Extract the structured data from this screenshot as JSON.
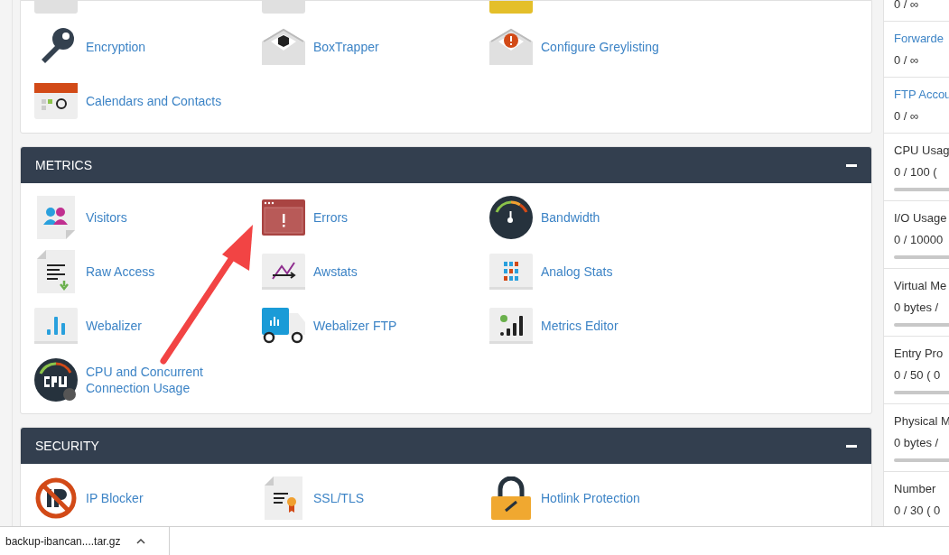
{
  "top_card": {
    "clipped_icons": [
      {
        "kind": "grey"
      },
      {
        "kind": "grey"
      },
      {
        "kind": "yellow"
      }
    ],
    "items": [
      {
        "label": "Encryption",
        "kind": "key"
      },
      {
        "label": "BoxTrapper",
        "kind": "box-envelope"
      },
      {
        "label": "Configure Greylisting",
        "kind": "alert-envelope"
      },
      {
        "label": "Calendars and Contacts",
        "kind": "calendar"
      }
    ]
  },
  "sections": [
    {
      "title": "METRICS",
      "expanded": true,
      "items": [
        {
          "label": "Visitors",
          "kind": "visitors"
        },
        {
          "label": "Errors",
          "kind": "errors"
        },
        {
          "label": "Bandwidth",
          "kind": "gauge"
        },
        {
          "label": "Raw Access",
          "kind": "raw"
        },
        {
          "label": "Awstats",
          "kind": "awstats"
        },
        {
          "label": "Analog Stats",
          "kind": "analog"
        },
        {
          "label": "Webalizer",
          "kind": "webalizer"
        },
        {
          "label": "Webalizer FTP",
          "kind": "truck"
        },
        {
          "label": "Metrics Editor",
          "kind": "metrics"
        },
        {
          "label": "CPU and Concurrent Connection Usage",
          "kind": "cpu"
        }
      ]
    },
    {
      "title": "SECURITY",
      "expanded": true,
      "items": [
        {
          "label": "IP Blocker",
          "kind": "ipblock"
        },
        {
          "label": "SSL/TLS",
          "kind": "cert"
        },
        {
          "label": "Hotlink Protection",
          "kind": "lock"
        }
      ]
    }
  ],
  "stats": [
    {
      "value": "0 / ∞"
    },
    {
      "label": "Forwarde",
      "link": true,
      "value": "0 / ∞"
    },
    {
      "label": "FTP Accou",
      "link": true,
      "value": "0 / ∞"
    },
    {
      "label": "CPU Usag",
      "link": false,
      "value": "0 / 100 (",
      "level": 0
    },
    {
      "label": "I/O Usage",
      "link": false,
      "value": "0 / 10000",
      "level": 0
    },
    {
      "label": "Virtual Me",
      "link": false,
      "value": "0 bytes /",
      "level": 0
    },
    {
      "label": "Entry Pro",
      "link": false,
      "value": "0 / 50 ( 0",
      "level": 0
    },
    {
      "label": "Physical M",
      "link": false,
      "value": "0 bytes /",
      "level": 0
    },
    {
      "label": "Number",
      "link": false,
      "value": "0 / 30 ( 0"
    }
  ],
  "downloads": {
    "file": "backup-ibancan....tar.gz"
  }
}
